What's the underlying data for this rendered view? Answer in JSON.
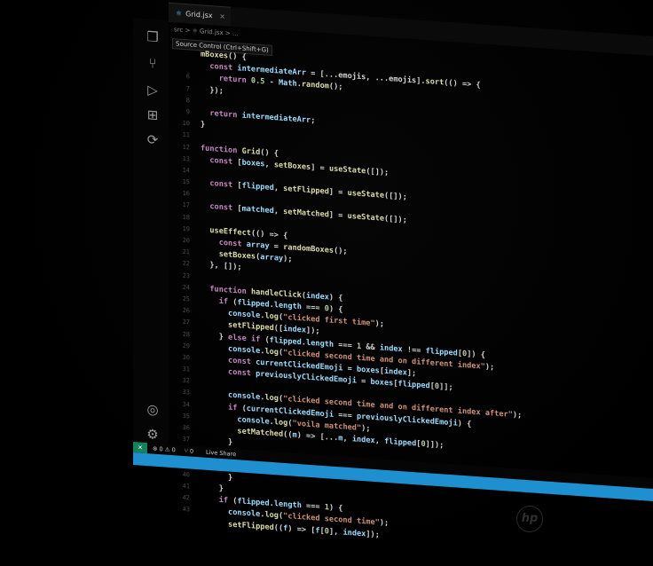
{
  "editor": {
    "tab": {
      "icon": "⚛",
      "label": "Grid.jsx",
      "close": "×"
    },
    "breadcrumb": "src > ⚛ Grid.jsx > ...",
    "tooltip": "Source Control (Ctrl+Shift+G)",
    "line_numbers": [
      "",
      "",
      "6",
      "7",
      "8",
      "9",
      "10",
      "11",
      "12",
      "13",
      "14",
      "15",
      "16",
      "17",
      "18",
      "19",
      "20",
      "21",
      "22",
      "23",
      "24",
      "25",
      "26",
      "27",
      "28",
      "29",
      "30",
      "31",
      "32",
      "33",
      "34",
      "35",
      "36",
      "37",
      "38",
      "39",
      "40",
      "41",
      "42",
      "43",
      ""
    ]
  },
  "activity_bar": {
    "icons": [
      "files-icon",
      "source-control-icon",
      "run-debug-icon",
      "extensions-icon",
      "remote-icon",
      "account-icon",
      "settings-icon"
    ]
  },
  "status_bar": {
    "remote": "✕",
    "problems": "⊗ 0 ⚠ 0",
    "ports": "⑂ 0",
    "live_share": "Live Share"
  },
  "brand": {
    "logo_text": "hp"
  },
  "code_lines": [
    [
      [
        "fn",
        "mBoxes"
      ],
      [
        "pl",
        "() {"
      ]
    ],
    [
      [
        "pl",
        "  "
      ],
      [
        "kw",
        "const "
      ],
      [
        "vr",
        "intermediateArr"
      ],
      [
        "pl",
        " = ["
      ],
      [
        "pl",
        "...emojis, ...emojis]."
      ],
      [
        "fn",
        "sort"
      ],
      [
        "pl",
        "(() => {"
      ]
    ],
    [
      [
        "pl",
        "    "
      ],
      [
        "kw",
        "return "
      ],
      [
        "nm",
        "0.5"
      ],
      [
        "pl",
        " - "
      ],
      [
        "vr",
        "Math"
      ],
      [
        "pl",
        "."
      ],
      [
        "fn",
        "random"
      ],
      [
        "pl",
        "();"
      ]
    ],
    [
      [
        "pl",
        "  });"
      ]
    ],
    [
      [
        "pl",
        ""
      ]
    ],
    [
      [
        "pl",
        "  "
      ],
      [
        "kw",
        "return "
      ],
      [
        "vr",
        "intermediateArr"
      ],
      [
        "pl",
        ";"
      ]
    ],
    [
      [
        "pl",
        "}"
      ]
    ],
    [
      [
        "pl",
        ""
      ]
    ],
    [
      [
        "kw",
        "function "
      ],
      [
        "fn",
        "Grid"
      ],
      [
        "pl",
        "() {"
      ]
    ],
    [
      [
        "pl",
        "  "
      ],
      [
        "kw",
        "const "
      ],
      [
        "pl",
        "["
      ],
      [
        "vr",
        "boxes"
      ],
      [
        "pl",
        ", "
      ],
      [
        "fn",
        "setBoxes"
      ],
      [
        "pl",
        "] = "
      ],
      [
        "fn",
        "useState"
      ],
      [
        "pl",
        "([]);"
      ]
    ],
    [
      [
        "pl",
        ""
      ]
    ],
    [
      [
        "pl",
        "  "
      ],
      [
        "kw",
        "const "
      ],
      [
        "pl",
        "["
      ],
      [
        "vr",
        "flipped"
      ],
      [
        "pl",
        ", "
      ],
      [
        "fn",
        "setFlipped"
      ],
      [
        "pl",
        "] = "
      ],
      [
        "fn",
        "useState"
      ],
      [
        "pl",
        "([]);"
      ]
    ],
    [
      [
        "pl",
        ""
      ]
    ],
    [
      [
        "pl",
        "  "
      ],
      [
        "kw",
        "const "
      ],
      [
        "pl",
        "["
      ],
      [
        "vr",
        "matched"
      ],
      [
        "pl",
        ", "
      ],
      [
        "fn",
        "setMatched"
      ],
      [
        "pl",
        "] = "
      ],
      [
        "fn",
        "useState"
      ],
      [
        "pl",
        "([]);"
      ]
    ],
    [
      [
        "pl",
        ""
      ]
    ],
    [
      [
        "pl",
        "  "
      ],
      [
        "fn",
        "useEffect"
      ],
      [
        "pl",
        "(() => {"
      ]
    ],
    [
      [
        "pl",
        "    "
      ],
      [
        "kw",
        "const "
      ],
      [
        "vr",
        "array"
      ],
      [
        "pl",
        " = "
      ],
      [
        "fn",
        "randomBoxes"
      ],
      [
        "pl",
        "();"
      ]
    ],
    [
      [
        "pl",
        "    "
      ],
      [
        "fn",
        "setBoxes"
      ],
      [
        "pl",
        "("
      ],
      [
        "vr",
        "array"
      ],
      [
        "pl",
        ");"
      ]
    ],
    [
      [
        "pl",
        "  }, []);"
      ]
    ],
    [
      [
        "pl",
        ""
      ]
    ],
    [
      [
        "pl",
        "  "
      ],
      [
        "kw",
        "function "
      ],
      [
        "fn",
        "handleClick"
      ],
      [
        "pl",
        "("
      ],
      [
        "vr",
        "index"
      ],
      [
        "pl",
        ") {"
      ]
    ],
    [
      [
        "pl",
        "    "
      ],
      [
        "kw",
        "if "
      ],
      [
        "pl",
        "("
      ],
      [
        "vr",
        "flipped"
      ],
      [
        "pl",
        "."
      ],
      [
        "vr",
        "length"
      ],
      [
        "pl",
        " === "
      ],
      [
        "nm",
        "0"
      ],
      [
        "pl",
        ") {"
      ]
    ],
    [
      [
        "pl",
        "      "
      ],
      [
        "vr",
        "console"
      ],
      [
        "pl",
        "."
      ],
      [
        "fn",
        "log"
      ],
      [
        "pl",
        "("
      ],
      [
        "st",
        "\"clicked first time\""
      ],
      [
        "pl",
        ");"
      ]
    ],
    [
      [
        "pl",
        "      "
      ],
      [
        "fn",
        "setFlipped"
      ],
      [
        "pl",
        "(["
      ],
      [
        "vr",
        "index"
      ],
      [
        "pl",
        "]);"
      ]
    ],
    [
      [
        "pl",
        "    } "
      ],
      [
        "kw",
        "else if "
      ],
      [
        "pl",
        "("
      ],
      [
        "vr",
        "flipped"
      ],
      [
        "pl",
        "."
      ],
      [
        "vr",
        "length"
      ],
      [
        "pl",
        " === "
      ],
      [
        "nm",
        "1"
      ],
      [
        "pl",
        " && "
      ],
      [
        "vr",
        "index"
      ],
      [
        "pl",
        " !== "
      ],
      [
        "vr",
        "flipped"
      ],
      [
        "pl",
        "["
      ],
      [
        "nm",
        "0"
      ],
      [
        "pl",
        "]) {"
      ]
    ],
    [
      [
        "pl",
        "      "
      ],
      [
        "vr",
        "console"
      ],
      [
        "pl",
        "."
      ],
      [
        "fn",
        "log"
      ],
      [
        "pl",
        "("
      ],
      [
        "st",
        "\"clicked second time and on different index\""
      ],
      [
        "pl",
        ");"
      ]
    ],
    [
      [
        "pl",
        "      "
      ],
      [
        "kw",
        "const "
      ],
      [
        "vr",
        "currentClickedEmoji"
      ],
      [
        "pl",
        " = "
      ],
      [
        "vr",
        "boxes"
      ],
      [
        "pl",
        "["
      ],
      [
        "vr",
        "index"
      ],
      [
        "pl",
        "];"
      ]
    ],
    [
      [
        "pl",
        "      "
      ],
      [
        "kw",
        "const "
      ],
      [
        "vr",
        "previouslyClickedEmoji"
      ],
      [
        "pl",
        " = "
      ],
      [
        "vr",
        "boxes"
      ],
      [
        "pl",
        "["
      ],
      [
        "vr",
        "flipped"
      ],
      [
        "pl",
        "["
      ],
      [
        "nm",
        "0"
      ],
      [
        "pl",
        "]];"
      ]
    ],
    [
      [
        "pl",
        ""
      ]
    ],
    [
      [
        "pl",
        "      "
      ],
      [
        "vr",
        "console"
      ],
      [
        "pl",
        "."
      ],
      [
        "fn",
        "log"
      ],
      [
        "pl",
        "("
      ],
      [
        "st",
        "\"clicked second time and on different index after\""
      ],
      [
        "pl",
        ");"
      ]
    ],
    [
      [
        "pl",
        "      "
      ],
      [
        "kw",
        "if "
      ],
      [
        "pl",
        "("
      ],
      [
        "vr",
        "currentClickedEmoji"
      ],
      [
        "pl",
        " === "
      ],
      [
        "vr",
        "previouslyClickedEmoji"
      ],
      [
        "pl",
        ") {"
      ]
    ],
    [
      [
        "pl",
        "        "
      ],
      [
        "vr",
        "console"
      ],
      [
        "pl",
        "."
      ],
      [
        "fn",
        "log"
      ],
      [
        "pl",
        "("
      ],
      [
        "st",
        "\"voila matched\""
      ],
      [
        "pl",
        ");"
      ]
    ],
    [
      [
        "pl",
        "        "
      ],
      [
        "fn",
        "setMatched"
      ],
      [
        "pl",
        "(("
      ],
      [
        "vr",
        "m"
      ],
      [
        "pl",
        ") => [..."
      ],
      [
        "vr",
        "m"
      ],
      [
        "pl",
        ", "
      ],
      [
        "vr",
        "index"
      ],
      [
        "pl",
        ", "
      ],
      [
        "vr",
        "flipped"
      ],
      [
        "pl",
        "["
      ],
      [
        "nm",
        "0"
      ],
      [
        "pl",
        "]]);"
      ]
    ],
    [
      [
        "pl",
        "      }"
      ]
    ],
    [
      [
        "pl",
        ""
      ]
    ],
    [
      [
        "pl",
        "        "
      ],
      [
        "fn",
        "setFlipped"
      ],
      [
        "pl",
        "([]);"
      ]
    ],
    [
      [
        "pl",
        "      }"
      ]
    ],
    [
      [
        "pl",
        "    }"
      ]
    ],
    [
      [
        "pl",
        "    "
      ],
      [
        "kw",
        "if "
      ],
      [
        "pl",
        "("
      ],
      [
        "vr",
        "flipped"
      ],
      [
        "pl",
        "."
      ],
      [
        "vr",
        "length"
      ],
      [
        "pl",
        " === "
      ],
      [
        "nm",
        "1"
      ],
      [
        "pl",
        ") {"
      ]
    ],
    [
      [
        "pl",
        "      "
      ],
      [
        "vr",
        "console"
      ],
      [
        "pl",
        "."
      ],
      [
        "fn",
        "log"
      ],
      [
        "pl",
        "("
      ],
      [
        "st",
        "\"clicked second time\""
      ],
      [
        "pl",
        ");"
      ]
    ],
    [
      [
        "pl",
        "      "
      ],
      [
        "fn",
        "setFlipped"
      ],
      [
        "pl",
        "(("
      ],
      [
        "vr",
        "f"
      ],
      [
        "pl",
        ") => ["
      ],
      [
        "vr",
        "f"
      ],
      [
        "pl",
        "["
      ],
      [
        "nm",
        "0"
      ],
      [
        "pl",
        "], "
      ],
      [
        "vr",
        "index"
      ],
      [
        "pl",
        "]);"
      ]
    ]
  ]
}
